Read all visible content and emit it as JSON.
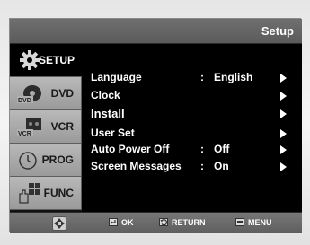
{
  "header": {
    "title": "Setup"
  },
  "sidebar": {
    "items": [
      {
        "label": "SETUP",
        "icon": "gear-icon",
        "active": true
      },
      {
        "label": "DVD",
        "icon": "dvd-disc-icon",
        "active": false
      },
      {
        "label": "VCR",
        "icon": "vcr-cassette-icon",
        "active": false
      },
      {
        "label": "PROG",
        "icon": "clock-icon",
        "active": false
      },
      {
        "label": "FUNC",
        "icon": "hand-grid-icon",
        "active": false
      }
    ]
  },
  "menu": {
    "items": [
      {
        "name": "Language",
        "colon": ":",
        "value": "English"
      },
      {
        "name": "Clock",
        "colon": "",
        "value": ""
      },
      {
        "name": "Install",
        "colon": "",
        "value": ""
      },
      {
        "name": "User Set",
        "colon": "",
        "value": ""
      },
      {
        "name": "Auto Power Off",
        "colon": ":",
        "value": "Off"
      },
      {
        "name": "Screen Messages",
        "colon": ":",
        "value": "On"
      }
    ]
  },
  "footer": {
    "nav_icon": "directional-pad-icon",
    "ok_label": "OK",
    "return_label": "RETURN",
    "menu_label": "MENU"
  },
  "colors": {
    "menu_background": "#000000",
    "bar_gray": "#666666",
    "tab_gray": "#aaaaaa",
    "text": "#ffffff"
  }
}
